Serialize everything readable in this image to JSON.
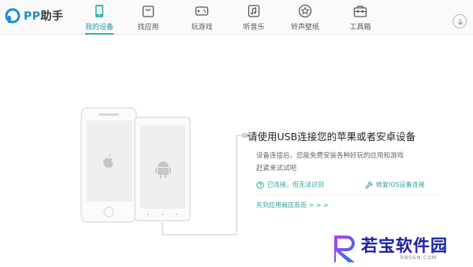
{
  "app": {
    "logo_pp": "PP",
    "logo_rest": "助手"
  },
  "nav": {
    "items": [
      {
        "label": "我的设备",
        "icon": "phone-icon",
        "active": true
      },
      {
        "label": "找应用",
        "icon": "bag-icon",
        "active": false
      },
      {
        "label": "玩游戏",
        "icon": "gamepad-icon",
        "active": false
      },
      {
        "label": "听音乐",
        "icon": "music-icon",
        "active": false
      },
      {
        "label": "铃声壁纸",
        "icon": "star-icon",
        "active": false
      },
      {
        "label": "工具箱",
        "icon": "toolbox-icon",
        "active": false
      }
    ],
    "download_icon": "download-icon"
  },
  "connect": {
    "title": "请使用USB连接您的苹果或者安卓设备",
    "desc_line1": "设备连接后，您能免费安装各种好玩的应用和游戏",
    "desc_line2": "赶紧来试试吧",
    "status_left": "已连接，但无法识别",
    "status_right": "修复IOS设备连接",
    "appstore_link": "先到应用商店逛逛 > > >"
  },
  "watermark": {
    "title": "若宝软件园",
    "sub": "RBSGN.COM"
  },
  "colors": {
    "accent": "#2aa39d",
    "logo_blue": "#1a8fd4",
    "watermark": "#1a1fa8"
  }
}
